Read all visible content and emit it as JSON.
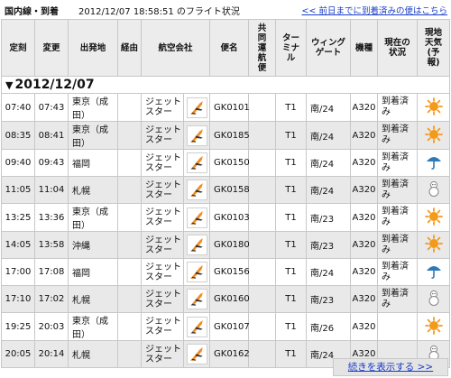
{
  "header": {
    "section": "国内線・到着",
    "datetime_status": "2012/12/07 18:58:51 のフライト状況",
    "prev_link": "<< 前日までに到着済みの便はこちら"
  },
  "columns": [
    "定刻",
    "変更",
    "出発地",
    "経由",
    "航空会社",
    "便名",
    "共同運航便",
    "ターミナル",
    "ウィングゲート",
    "機種",
    "現在の状況",
    "現地天気(予報)"
  ],
  "date_label": "2012/12/07",
  "flights": [
    {
      "sched": "07:40",
      "chg": "07:43",
      "from": "東京（成田）",
      "via": "",
      "airline": "ジェットスター",
      "flight": "GK0101",
      "codeshare": "",
      "terminal": "T1",
      "gate": "南/24",
      "aircraft": "A320",
      "status": "到着済み",
      "weather": "sunny-icon"
    },
    {
      "sched": "08:35",
      "chg": "08:41",
      "from": "東京（成田）",
      "via": "",
      "airline": "ジェットスター",
      "flight": "GK0185",
      "codeshare": "",
      "terminal": "T1",
      "gate": "南/24",
      "aircraft": "A320",
      "status": "到着済み",
      "weather": "sunny-icon"
    },
    {
      "sched": "09:40",
      "chg": "09:43",
      "from": "福岡",
      "via": "",
      "airline": "ジェットスター",
      "flight": "GK0150",
      "codeshare": "",
      "terminal": "T1",
      "gate": "南/24",
      "aircraft": "A320",
      "status": "到着済み",
      "weather": "umbrella-icon"
    },
    {
      "sched": "11:05",
      "chg": "11:04",
      "from": "札幌",
      "via": "",
      "airline": "ジェットスター",
      "flight": "GK0158",
      "codeshare": "",
      "terminal": "T1",
      "gate": "南/24",
      "aircraft": "A320",
      "status": "到着済み",
      "weather": "snowman-icon"
    },
    {
      "sched": "13:25",
      "chg": "13:36",
      "from": "東京（成田）",
      "via": "",
      "airline": "ジェットスター",
      "flight": "GK0103",
      "codeshare": "",
      "terminal": "T1",
      "gate": "南/23",
      "aircraft": "A320",
      "status": "到着済み",
      "weather": "sunny-icon"
    },
    {
      "sched": "14:05",
      "chg": "13:58",
      "from": "沖縄",
      "via": "",
      "airline": "ジェットスター",
      "flight": "GK0180",
      "codeshare": "",
      "terminal": "T1",
      "gate": "南/23",
      "aircraft": "A320",
      "status": "到着済み",
      "weather": "sunny-icon"
    },
    {
      "sched": "17:00",
      "chg": "17:08",
      "from": "福岡",
      "via": "",
      "airline": "ジェットスター",
      "flight": "GK0156",
      "codeshare": "",
      "terminal": "T1",
      "gate": "南/24",
      "aircraft": "A320",
      "status": "到着済み",
      "weather": "umbrella-icon"
    },
    {
      "sched": "17:10",
      "chg": "17:02",
      "from": "札幌",
      "via": "",
      "airline": "ジェットスター",
      "flight": "GK0160",
      "codeshare": "",
      "terminal": "T1",
      "gate": "南/23",
      "aircraft": "A320",
      "status": "到着済み",
      "weather": "snowman-icon"
    },
    {
      "sched": "19:25",
      "chg": "20:03",
      "from": "東京（成田）",
      "via": "",
      "airline": "ジェットスター",
      "flight": "GK0107",
      "codeshare": "",
      "terminal": "T1",
      "gate": "南/26",
      "aircraft": "A320",
      "status": "",
      "weather": "sunny-icon"
    },
    {
      "sched": "20:05",
      "chg": "20:14",
      "from": "札幌",
      "via": "",
      "airline": "ジェットスター",
      "flight": "GK0162",
      "codeshare": "",
      "terminal": "T1",
      "gate": "南/24",
      "aircraft": "A320",
      "status": "",
      "weather": "snowman-icon"
    }
  ],
  "more_link": "続きを表示する >>",
  "colors": {
    "link": "#1a3dc8",
    "header_bg": "#ececec",
    "alt_row": "#e9e9e9",
    "sun": "#f39a1c",
    "rain": "#2c7ab8",
    "brand_orange": "#f28c1e"
  }
}
